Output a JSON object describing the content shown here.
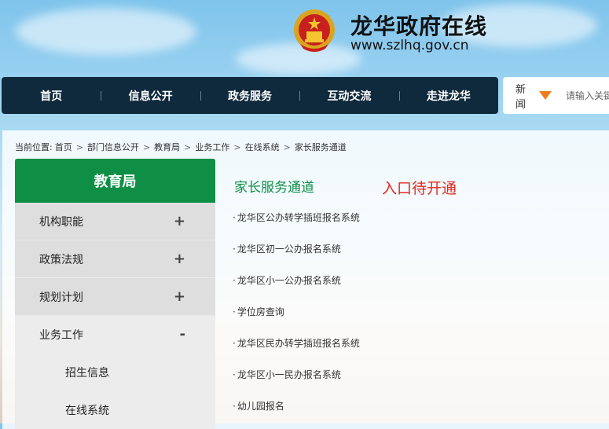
{
  "header": {
    "site_title": "龙华政府在线",
    "site_url": "www.szlhq.gov.cn"
  },
  "nav": {
    "items": [
      "首页",
      "信息公开",
      "政务服务",
      "互动交流",
      "走进龙华"
    ]
  },
  "search": {
    "category": "新闻",
    "placeholder": "请输入关键字",
    "accent_color": "#f07d1b"
  },
  "breadcrumb": {
    "label": "当前位置:",
    "items": [
      "首页",
      "部门信息公开",
      "教育局",
      "业务工作",
      "在线系统",
      "家长服务通道"
    ]
  },
  "sidebar": {
    "title": "教育局",
    "header_color": "#0e8f45",
    "items": [
      {
        "label": "机构职能",
        "toggle": "+"
      },
      {
        "label": "政策法规",
        "toggle": "+"
      },
      {
        "label": "规划计划",
        "toggle": "+"
      },
      {
        "label": "业务工作",
        "toggle": "-"
      }
    ],
    "sub_items": [
      "招生信息",
      "在线系统"
    ]
  },
  "main": {
    "section_title": "家长服务通道",
    "notice": "入口待开通",
    "notice_color": "#e02a1f",
    "links": [
      "龙华区公办转学插班报名系统",
      "龙华区初一公办报名系统",
      "龙华区小一公办报名系统",
      "学位房查询",
      "龙华区民办转学插班报名系统",
      "龙华区小一民办报名系统",
      "幼儿园报名"
    ]
  }
}
